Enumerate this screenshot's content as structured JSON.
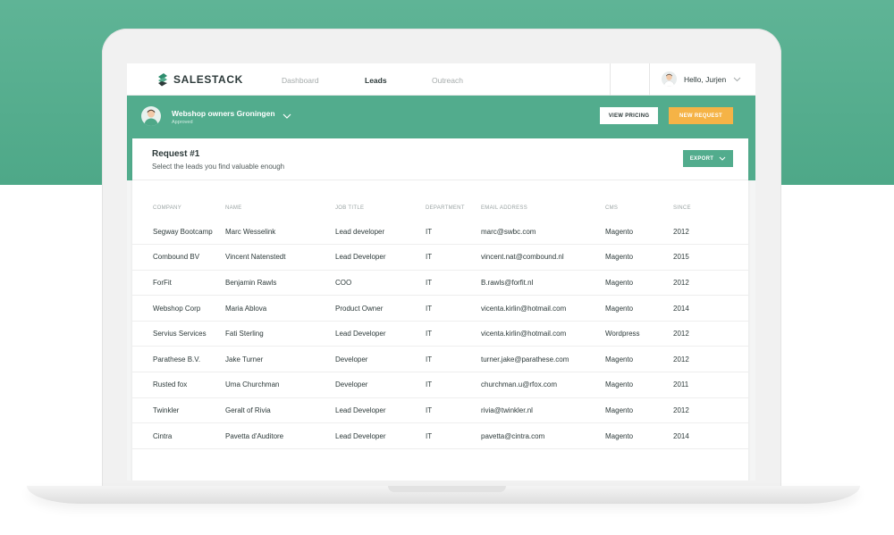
{
  "nav": {
    "brand": "SALESTACK",
    "items": [
      "Dashboard",
      "Leads",
      "Outreach"
    ],
    "active": "Leads",
    "user_greeting": "Hello, Jurjen"
  },
  "segment": {
    "title": "Webshop owners Groningen",
    "status": "Approved",
    "view_pricing_label": "VIEW PRICING",
    "new_request_label": "NEW REQUEST"
  },
  "request": {
    "title": "Request #1",
    "subtitle": "Select the leads you find valuable enough",
    "export_label": "EXPORT"
  },
  "table": {
    "headers": [
      "COMPANY",
      "NAME",
      "JOB TITLE",
      "DEPARTMENT",
      "EMAIL ADDRESS",
      "CMS",
      "SINCE"
    ],
    "rows": [
      [
        "Segway Bootcamp",
        "Marc Wesselink",
        "Lead developer",
        "IT",
        "marc@swbc.com",
        "Magento",
        "2012"
      ],
      [
        "Combound BV",
        "Vincent Natenstedt",
        "Lead Developer",
        "IT",
        "vincent.nat@combound.nl",
        "Magento",
        "2015"
      ],
      [
        "ForFit",
        "Benjamin Rawls",
        "COO",
        "IT",
        "B.rawls@forfit.nl",
        "Magento",
        "2012"
      ],
      [
        "Webshop Corp",
        "Maria Ablova",
        "Product Owner",
        "IT",
        "vicenta.kirlin@hotmail.com",
        "Magento",
        "2014"
      ],
      [
        "Servius Services",
        "Fati Sterling",
        "Lead Developer",
        "IT",
        "vicenta.kirlin@hotmail.com",
        "Wordpress",
        "2012"
      ],
      [
        "Parathese B.V.",
        "Jake Turner",
        "Developer",
        "IT",
        "turner.jake@parathese.com",
        "Magento",
        "2012"
      ],
      [
        "Rusted fox",
        "Uma Churchman",
        "Developer",
        "IT",
        "churchman.u@rfox.com",
        "Magento",
        "2011"
      ],
      [
        "Twinkler",
        "Geralt of Rivia",
        "Lead Developer",
        "IT",
        "rivia@twinkler.nl",
        "Magento",
        "2012"
      ],
      [
        "Cintra",
        "Pavetta d'Auditore",
        "Lead Developer",
        "IT",
        "pavetta@cintra.com",
        "Magento",
        "2014"
      ]
    ]
  },
  "colors": {
    "brand_green": "#52ac8d",
    "accent_orange": "#f5b346",
    "text_dark": "#2d3a3a"
  },
  "icons": [
    "salestack-logo-icon",
    "avatar",
    "chevron-down-icon"
  ]
}
